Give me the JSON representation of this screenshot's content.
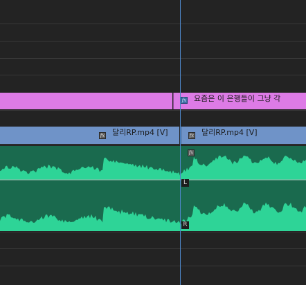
{
  "colors": {
    "background": "#232323",
    "subtitle_clip": "#dd7be6",
    "video_clip": "#6f93c8",
    "audio_clip_bg": "#1a6a4e",
    "waveform": "#2ed497",
    "playhead": "#4d86c8"
  },
  "tracks": {
    "subtitle": {
      "clip_right_label": "요즘은 이 은행들이 그냥 각",
      "clip_right_icon": "fx-icon"
    },
    "video": {
      "clip_left_label": "달리RP.mp4 [V]",
      "clip_left_icon": "fx-icon",
      "clip_right_label": "달리RP.mp4 [V]",
      "clip_right_icon": "fx-icon"
    },
    "audio": {
      "clip_icon": "fx-icon",
      "channel_left": "L",
      "channel_right": "R"
    }
  },
  "fx_glyph": "fx"
}
